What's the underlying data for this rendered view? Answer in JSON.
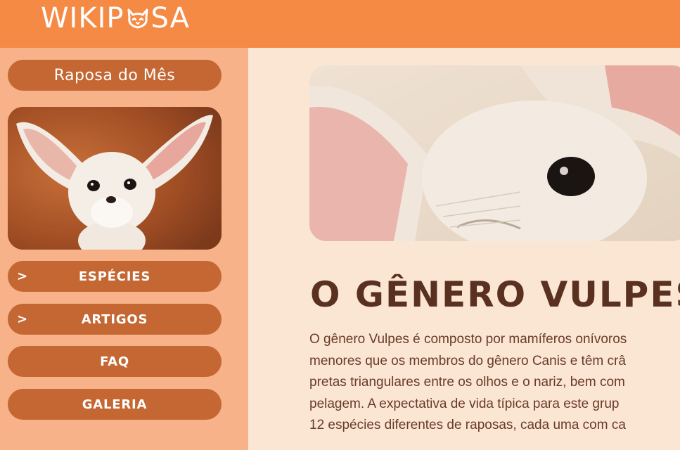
{
  "header": {
    "logo_text_a": "WIKIP",
    "logo_text_b": "SA",
    "logo_icon": "fox-face-icon",
    "bg_color": "#f58a45"
  },
  "sidebar": {
    "featured_title": "Raposa do Mês",
    "featured_image": "fennec-fox-photo",
    "nav": [
      {
        "label": "ESPÉCIES",
        "chevron": ">"
      },
      {
        "label": "ARTIGOS",
        "chevron": ">"
      },
      {
        "label": "FAQ"
      },
      {
        "label": "GALERIA"
      }
    ],
    "bg_color": "#f7b28a",
    "pill_color": "#c56733"
  },
  "main": {
    "hero_image": "fennec-fox-closeup-photo",
    "heading": "O GÊNERO VULPES",
    "paragraph_lines": [
      "O gênero Vulpes é composto por mamíferos onívoros",
      "menores que os membros do gênero Canis e têm crâ",
      "pretas triangulares entre os olhos e o nariz, bem com",
      "pelagem. A expectativa de vida típica para este grup",
      "12 espécies diferentes de raposas, cada uma com ca"
    ],
    "bg_color": "#fbe6d4",
    "text_color": "#5a3121"
  }
}
